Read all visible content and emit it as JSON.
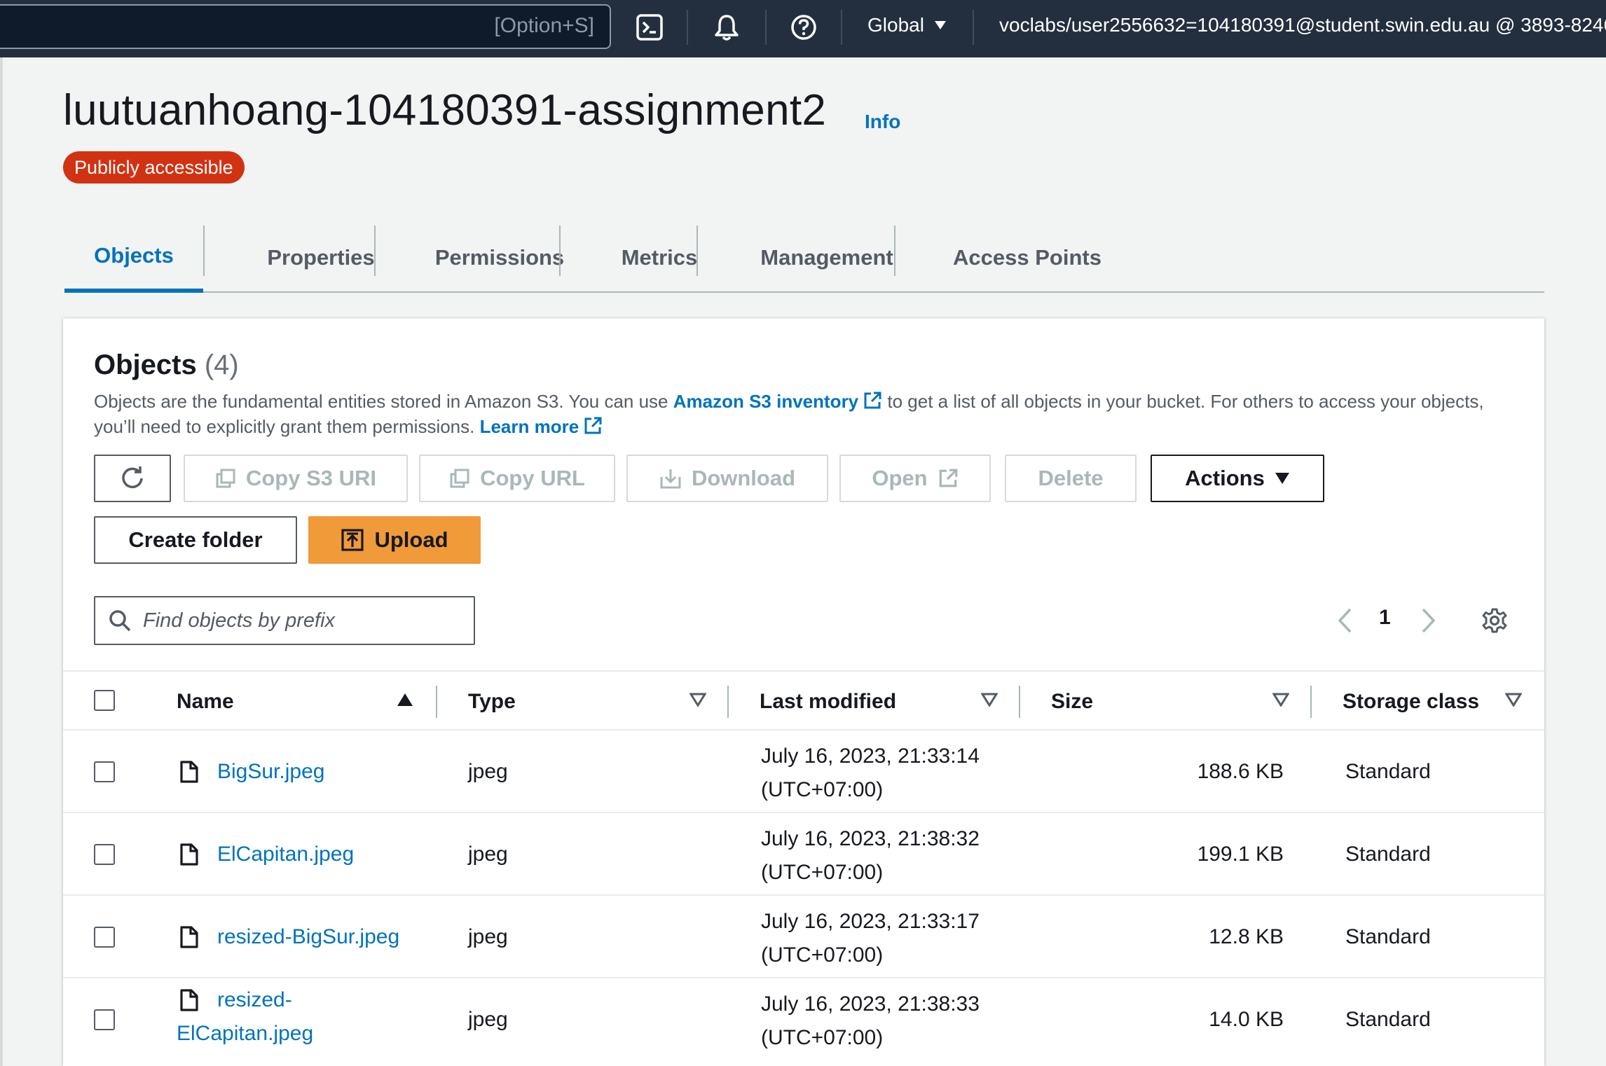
{
  "topbar": {
    "search_shortcut": "[Option+S]",
    "icons": [
      "cloudshell-icon",
      "bell-icon",
      "help-icon"
    ],
    "region": "Global",
    "account": "voclabs/user2556632=104180391@student.swin.edu.au @ 3893-8246..."
  },
  "bucket": {
    "name": "luutuanhoang-104180391-assignment2",
    "info_label": "Info",
    "access_badge": "Publicly accessible"
  },
  "tabs": [
    {
      "label": "Objects",
      "active": true
    },
    {
      "label": "Properties"
    },
    {
      "label": "Permissions"
    },
    {
      "label": "Metrics"
    },
    {
      "label": "Management"
    },
    {
      "label": "Access Points"
    }
  ],
  "objects_panel": {
    "heading": "Objects",
    "count": "(4)",
    "desc_part1": "Objects are the fundamental entities stored in Amazon S3. You can use ",
    "desc_link1": "Amazon S3 inventory",
    "desc_part2": " to get a list of all objects in your bucket. For others to access your objects, you’ll need to explicitly grant them permissions. ",
    "desc_link2": "Learn more",
    "buttons": {
      "copy_s3_uri": "Copy S3 URI",
      "copy_url": "Copy URL",
      "download": "Download",
      "open": "Open",
      "delete": "Delete",
      "actions": "Actions",
      "create_folder": "Create folder",
      "upload": "Upload"
    },
    "search_placeholder": "Find objects by prefix",
    "page": "1"
  },
  "table": {
    "columns": [
      "Name",
      "Type",
      "Last modified",
      "Size",
      "Storage class"
    ],
    "rows": [
      {
        "name": "BigSur.jpeg",
        "type": "jpeg",
        "modified_date": "July 16, 2023, 21:33:14",
        "modified_tz": "(UTC+07:00)",
        "size": "188.6 KB",
        "storage": "Standard"
      },
      {
        "name": "ElCapitan.jpeg",
        "type": "jpeg",
        "modified_date": "July 16, 2023, 21:38:32",
        "modified_tz": "(UTC+07:00)",
        "size": "199.1 KB",
        "storage": "Standard"
      },
      {
        "name": "resized-BigSur.jpeg",
        "type": "jpeg",
        "modified_date": "July 16, 2023, 21:33:17",
        "modified_tz": "(UTC+07:00)",
        "size": "12.8 KB",
        "storage": "Standard"
      },
      {
        "name_line1": "resized-",
        "name_line2": "ElCapitan.jpeg",
        "type": "jpeg",
        "modified_date": "July 16, 2023, 21:38:33",
        "modified_tz": "(UTC+07:00)",
        "size": "14.0 KB",
        "storage": "Standard"
      }
    ]
  },
  "colors": {
    "topbar": "#232f3e",
    "link": "#0073bb",
    "badge": "#d13212",
    "primary_button": "#f09a3a"
  }
}
